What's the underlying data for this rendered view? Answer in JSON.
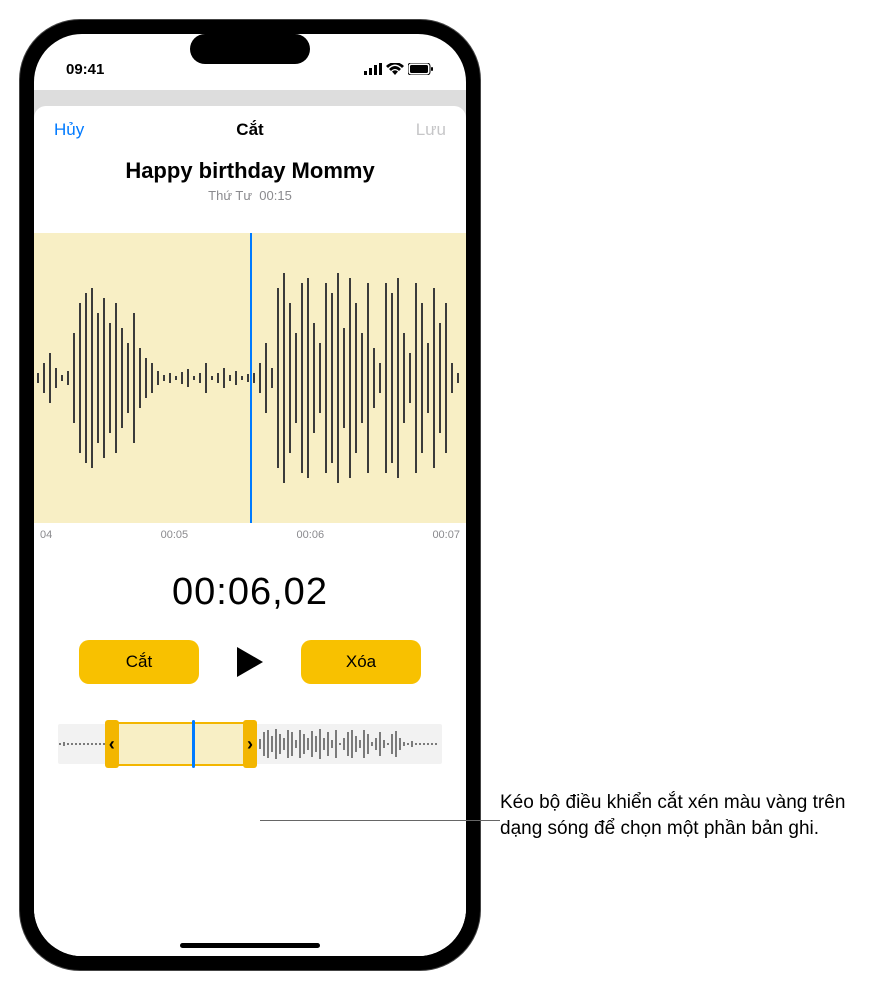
{
  "status": {
    "time": "09:41"
  },
  "nav": {
    "cancel": "Hủy",
    "title": "Cắt",
    "save": "Lưu"
  },
  "recording": {
    "title": "Happy birthday Mommy",
    "day": "Thứ Tư",
    "duration": "00:15"
  },
  "timeline": {
    "ticks": [
      "04",
      "00:05",
      "00:06",
      "00:07"
    ]
  },
  "playback": {
    "position": "00:06,02"
  },
  "buttons": {
    "trim": "Cắt",
    "delete": "Xóa"
  },
  "trim": {
    "start_pct": 14,
    "end_pct": 50,
    "playhead_pct": 35
  },
  "callout": "Kéo bộ điều khiển cắt xén màu vàng trên dạng sóng để chọn một phần bản ghi.",
  "colors": {
    "accent_blue": "#007aff",
    "accent_yellow": "#f8c100",
    "wave_bg": "#f8efc5"
  }
}
